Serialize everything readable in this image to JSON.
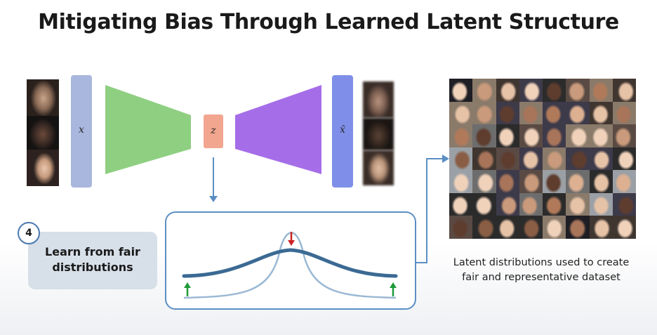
{
  "slide": {
    "title": "Mitigating Bias Through Learned Latent Structure"
  },
  "autoencoder": {
    "input_label": "x",
    "latent_label": "z",
    "output_label": "x̂",
    "colors": {
      "input_bar": "#a9b6dd",
      "encoder": "#8fcf82",
      "latent": "#f2a58f",
      "decoder": "#a56ee8",
      "output_bar": "#7f8fe9"
    }
  },
  "step": {
    "number": "4",
    "label_line1": "Learn from fair",
    "label_line2": "distributions"
  },
  "distribution_panel": {
    "colors": {
      "border": "#5b8fc4",
      "wide_curve": "#3b6a93",
      "narrow_curve": "#9ab8d3",
      "down_arrow": "#cc2222",
      "up_arrow": "#1f9a3a"
    }
  },
  "caption": {
    "line1": "Latent distributions used to create",
    "line2": "fair and representative dataset"
  }
}
